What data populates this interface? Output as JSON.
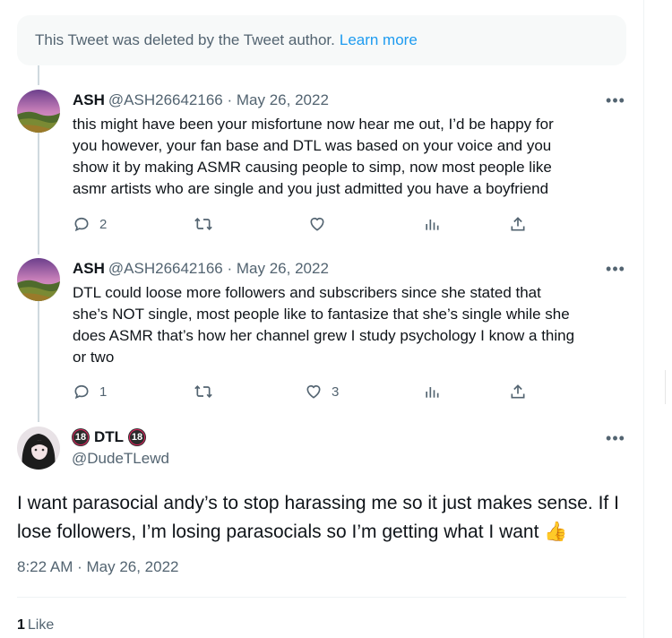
{
  "deleted_notice": {
    "text": "This Tweet was deleted by the Tweet author.",
    "link": "Learn more"
  },
  "replies": [
    {
      "name": "ASH",
      "handle": "@ASH26642166",
      "date": "· May 26, 2022",
      "lines": [
        "this might have been your misfortune now hear me out, I’d be happy for",
        "you however, your fan base and DTL was based on your voice and you",
        "show it by making ASMR causing people to simp, now most people like",
        "asmr artists who are single and you just admitted you have a boyfriend"
      ],
      "reply_count": "2",
      "retweet_count": "",
      "like_count": "",
      "more_icon": "more-dots-icon"
    },
    {
      "name": "ASH",
      "handle": "@ASH26642166",
      "date": "· May 26, 2022",
      "lines": [
        "DTL could loose more followers and subscribers since she stated that",
        "she’s NOT single, most people like to fantasize that she’s single while she",
        "does ASMR that’s how her channel grew I study psychology I know a thing",
        "or two"
      ],
      "reply_count": "1",
      "retweet_count": "",
      "like_count": "3",
      "more_icon": "more-dots-icon"
    }
  ],
  "main_tweet": {
    "name": "DTL",
    "badge": "18",
    "handle": "@DudeTLewd",
    "text_line1": "I want parasocial andy’s to stop harassing me so it just makes sense. If I",
    "text_line2": "lose followers, I’m losing parasocials so I’m getting what I want",
    "emoji": "👍",
    "timestamp": "8:22 AM · May 26, 2022",
    "like_count": "1",
    "like_label": "Like"
  },
  "colors": {
    "accent": "#1d9bf0",
    "secondary_text": "#536471",
    "primary_text": "#0f1419",
    "thread_line": "#cfd9de"
  },
  "icons": [
    "reply-icon",
    "retweet-icon",
    "like-icon",
    "views-icon",
    "share-icon",
    "more-dots-icon"
  ]
}
